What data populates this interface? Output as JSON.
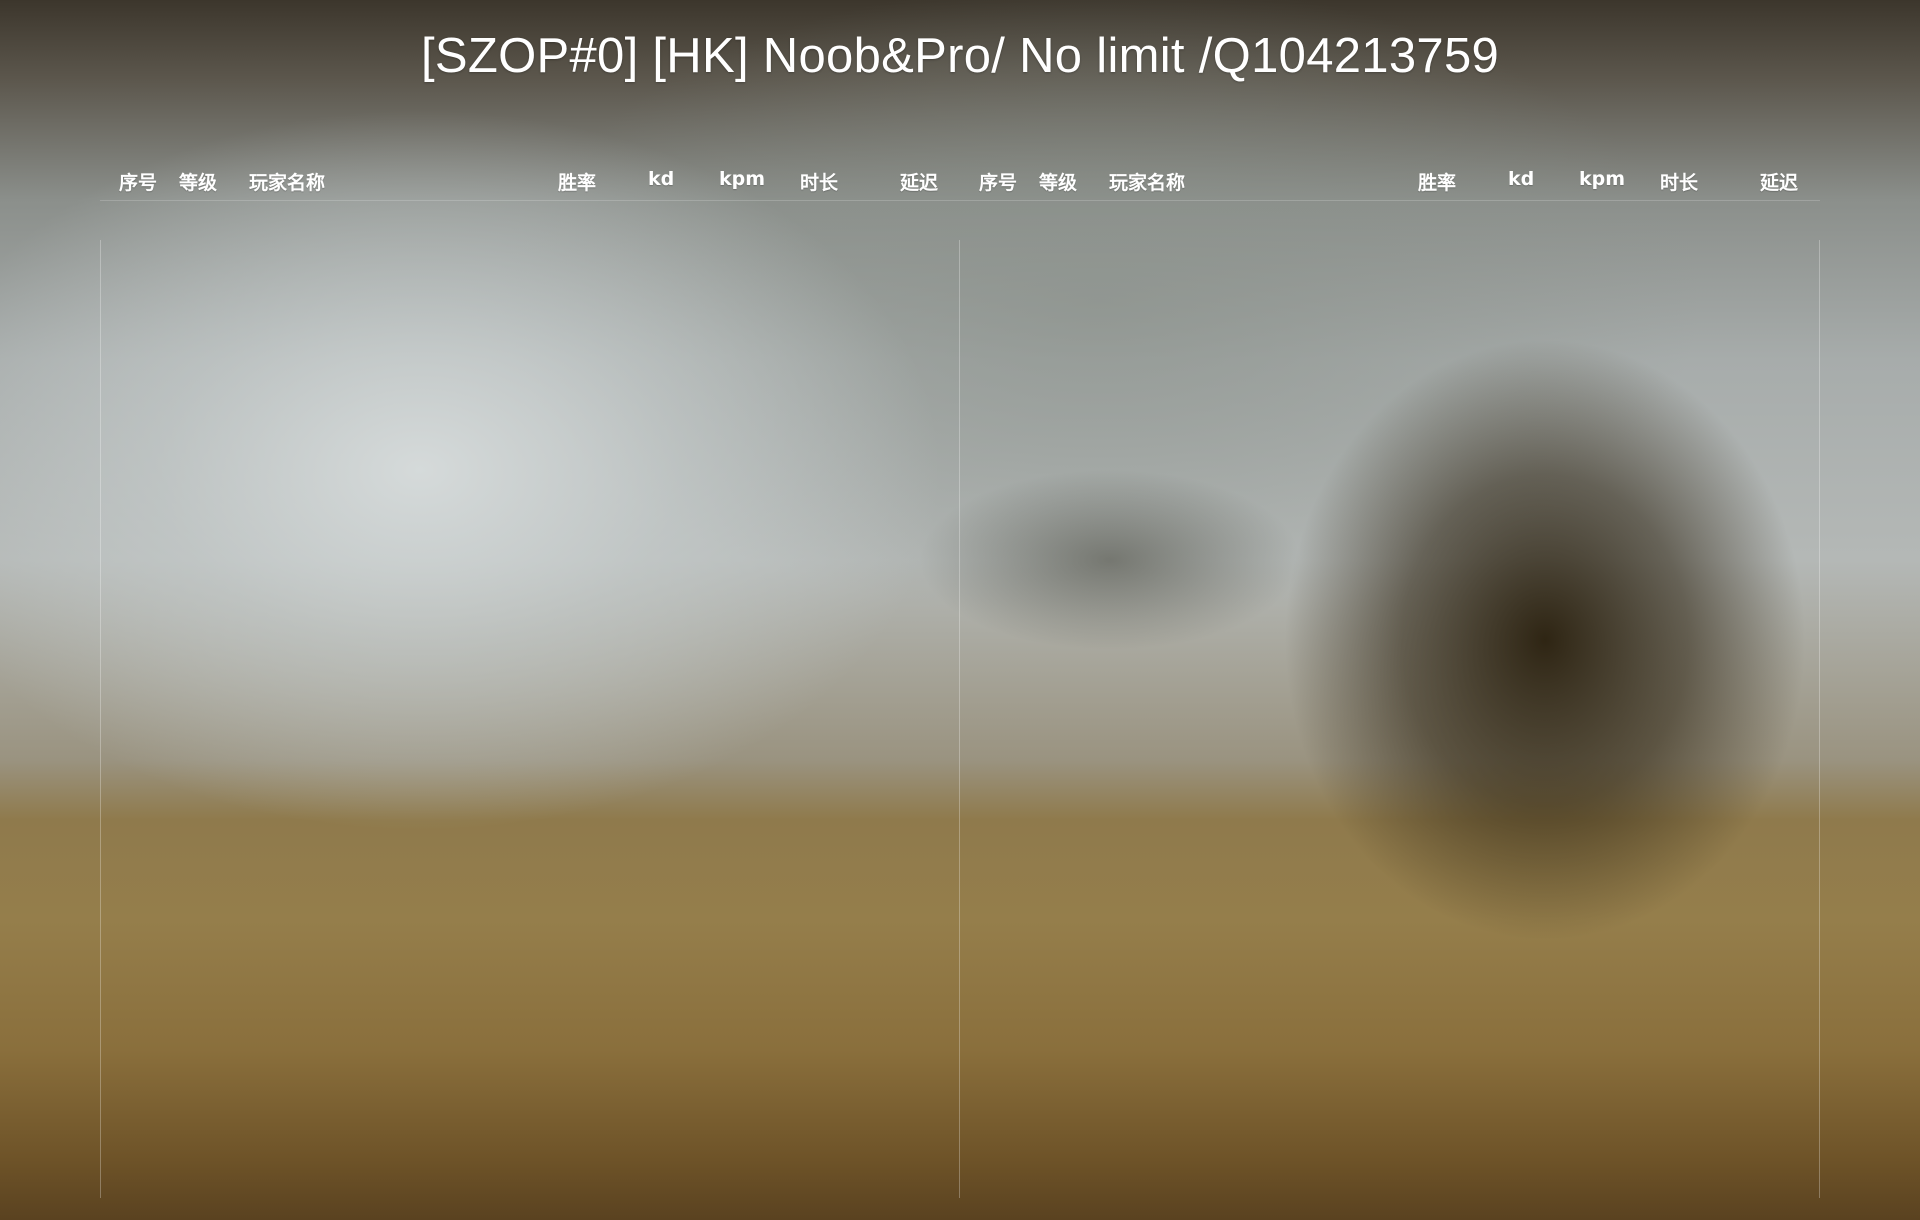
{
  "server": {
    "title": "[SZOP#0] [HK] Noob&Pro/ No limit /Q104213759"
  },
  "columns": {
    "index": "序号",
    "level": "等级",
    "player_name": "玩家名称",
    "win_rate": "胜率",
    "kd": "kd",
    "kpm": "kpm",
    "duration": "时长",
    "latency": "延迟"
  },
  "teams": [
    {
      "players": []
    },
    {
      "players": []
    }
  ]
}
